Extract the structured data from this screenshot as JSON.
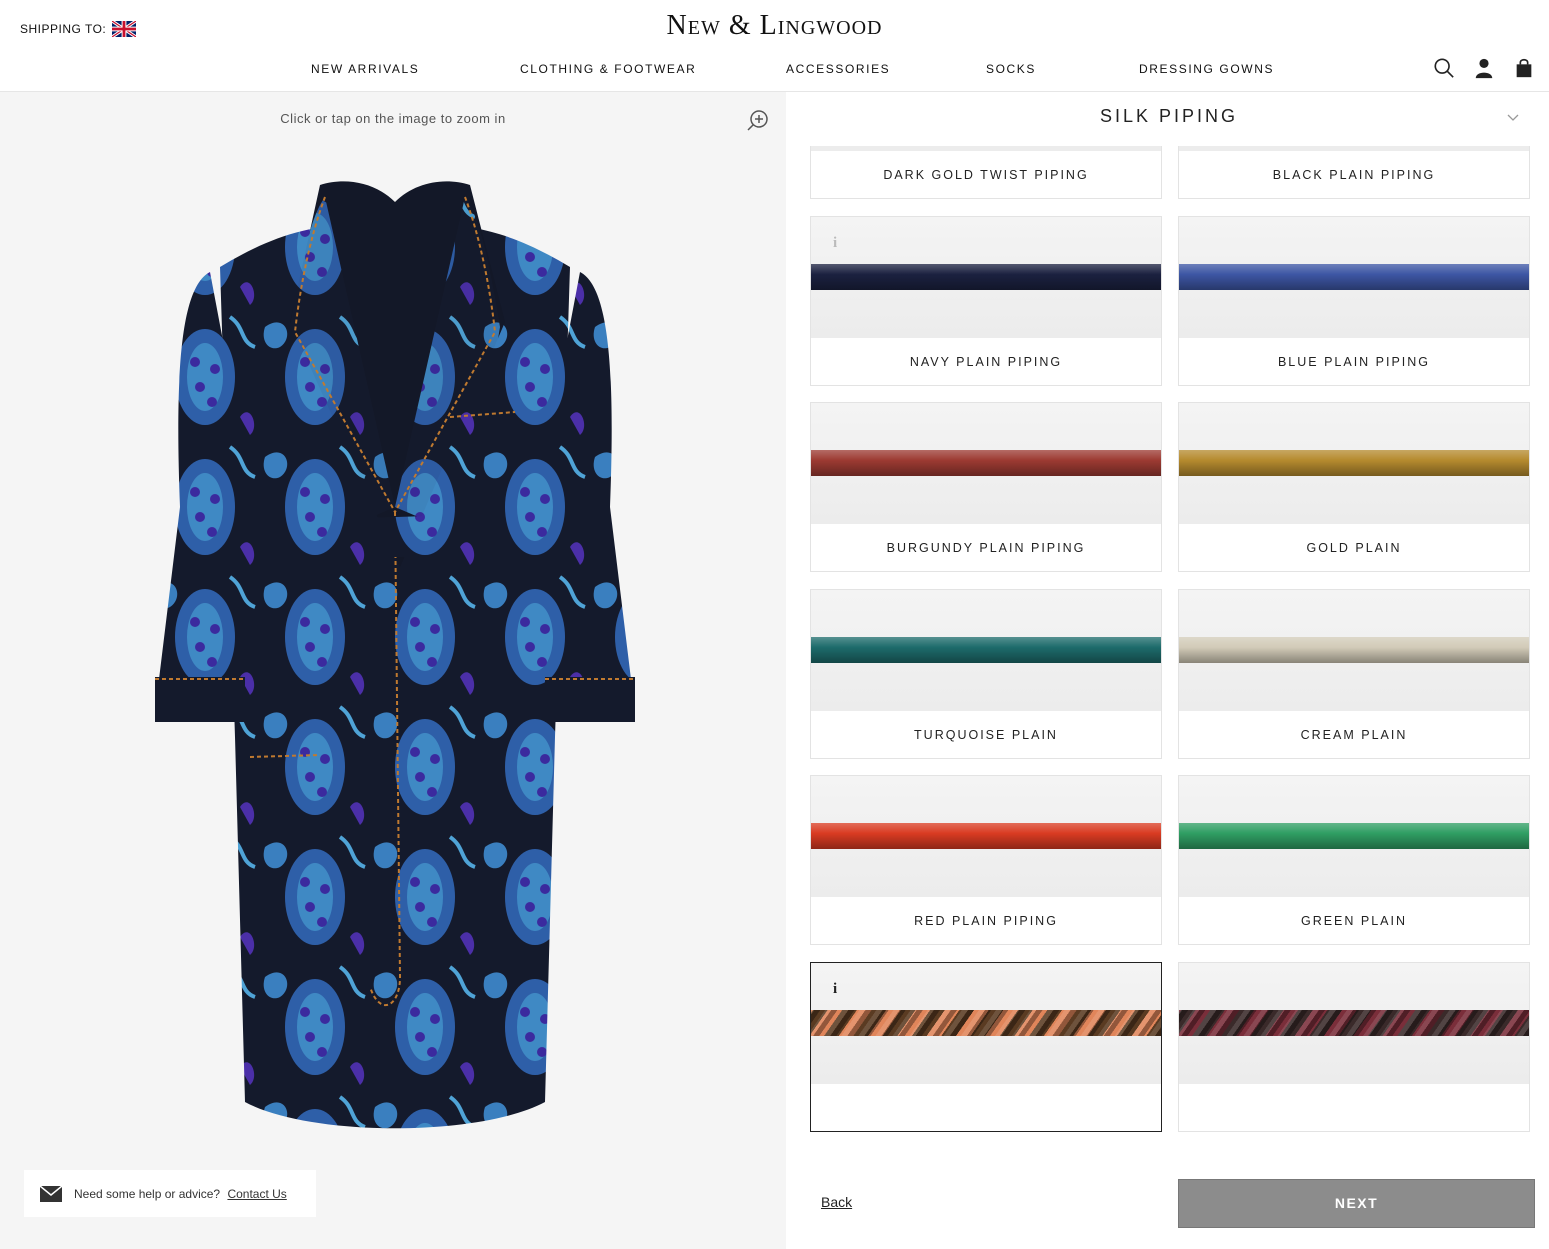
{
  "header": {
    "shipping_label": "SHIPPING TO:",
    "logo": "New & Lingwood",
    "nav": [
      "NEW ARRIVALS",
      "CLOTHING & FOOTWEAR",
      "ACCESSORIES",
      "SOCKS",
      "DRESSING GOWNS"
    ],
    "icons": [
      "search-icon",
      "account-icon",
      "bag-icon"
    ]
  },
  "viewer": {
    "zoom_hint": "Click or tap on the image to zoom in",
    "help_text": "Need some help or advice?",
    "contact_link": "Contact Us"
  },
  "configurator": {
    "section_title": "SILK PIPING",
    "options": [
      {
        "label": "DARK GOLD TWIST PIPING",
        "color": "#8a6a2c",
        "twist": true,
        "info": false,
        "selected": false
      },
      {
        "label": "BLACK PLAIN PIPING",
        "color": "#1e1e1e",
        "twist": false,
        "info": false,
        "selected": false
      },
      {
        "label": "NAVY PLAIN PIPING",
        "color": "#1b2140",
        "twist": false,
        "info": true,
        "selected": false
      },
      {
        "label": "BLUE PLAIN PIPING",
        "color": "#3d56a4",
        "twist": false,
        "info": false,
        "selected": false
      },
      {
        "label": "BURGUNDY PLAIN PIPING",
        "color": "#9c3a32",
        "twist": false,
        "info": false,
        "selected": false
      },
      {
        "label": "GOLD PLAIN",
        "color": "#b58a2e",
        "twist": false,
        "info": false,
        "selected": false
      },
      {
        "label": "TURQUOISE PLAIN",
        "color": "#1d6b6b",
        "twist": false,
        "info": false,
        "selected": false
      },
      {
        "label": "CREAM PLAIN",
        "color": "#d2cbb8",
        "twist": false,
        "info": false,
        "selected": false
      },
      {
        "label": "RED PLAIN PIPING",
        "color": "#d93b22",
        "twist": false,
        "info": false,
        "selected": false
      },
      {
        "label": "GREEN PLAIN",
        "color": "#2f9e63",
        "twist": false,
        "info": false,
        "selected": false
      },
      {
        "label": "",
        "color": "#5a3b22",
        "color2": "#e0855a",
        "twist": true,
        "info": true,
        "selected": true
      },
      {
        "label": "",
        "color": "#3a2a2a",
        "color2": "#7a2e3a",
        "twist": true,
        "info": false,
        "selected": false
      }
    ],
    "back_label": "Back",
    "next_label": "NEXT"
  }
}
